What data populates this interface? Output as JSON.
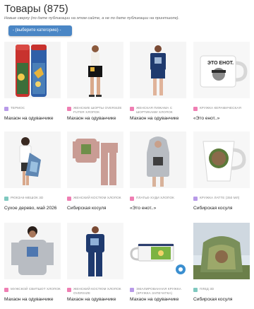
{
  "page": {
    "title": "Товары (875)",
    "note": "Новые сверху (по дате публикации на этом сайте, а не по дате публикации на принтшопе).",
    "category_select": "- (выберите категорию) -"
  },
  "colors": {
    "accent": "#4a86c5",
    "tag_purple": "#b89ae8",
    "tag_pink": "#ef7fb3",
    "tag_teal": "#7fc8bf"
  },
  "products": [
    {
      "tag": "ТЕРМОС",
      "name": "Махаон на одуванчике",
      "tag_color": "#b89ae8",
      "icon": "thermos-image"
    },
    {
      "tag": "ЖЕНСКИЕ ШОРТЫ OVERSIZE FUTER ХЛОПОК",
      "name": "Махаон на одуванчике",
      "tag_color": "#ef7fb3",
      "icon": "shorts-image"
    },
    {
      "tag": "ЖЕНСКАЯ ПИЖАМА С ШОРТИКАМИ ХЛОПОК",
      "name": "Махаон на одуванчике",
      "tag_color": "#ef7fb3",
      "icon": "pajama-image"
    },
    {
      "tag": "КРУЖКА КЕРАМИЧЕСКАЯ",
      "name": "«Это енот..»",
      "tag_color": "#ef7fb3",
      "icon": "mug-image"
    },
    {
      "tag": "РЮКЗАК-МЕШОК 3D",
      "name": "Сухое дерево, май 2026",
      "tag_color": "#7fc8bf",
      "icon": "backpack-image"
    },
    {
      "tag": "ЖЕНСКИЙ КОСТЮМ ХЛОПОК",
      "name": "Сибирская косуля",
      "tag_color": "#ef7fb3",
      "icon": "suit-image"
    },
    {
      "tag": "ПЛАТЬЕ-ХУДИ ХЛОПОК",
      "name": "«Это енот..»",
      "tag_color": "#ef7fb3",
      "icon": "hoodie-dress-image"
    },
    {
      "tag": "КРУЖКА ЛАТТЕ (350 МЛ)",
      "name": "Сибирская косуля",
      "tag_color": "#b89ae8",
      "icon": "latte-mug-image"
    },
    {
      "tag": "МУЖСКОЙ СВИТШОТ ХЛОПОК",
      "name": "Махаон на одуванчике",
      "tag_color": "#ef7fb3",
      "icon": "sweatshirt-image"
    },
    {
      "tag": "ЖЕНСКИЙ КОСТЮМ ХЛОПОК OVERSIZE",
      "name": "Махаон на одуванчике",
      "tag_color": "#ef7fb3",
      "icon": "oversize-suit-image"
    },
    {
      "tag": "ЭМАЛИРОВАННАЯ КРУЖКА (КРУЖКА ЗАПЕЧАТКА)",
      "name": "Махаон на одуванчике",
      "tag_color": "#b89ae8",
      "icon": "enamel-mug-image"
    },
    {
      "tag": "ПЛЕД 3D",
      "name": "Сибирская косуля",
      "tag_color": "#7fc8bf",
      "icon": "blanket-image"
    }
  ]
}
